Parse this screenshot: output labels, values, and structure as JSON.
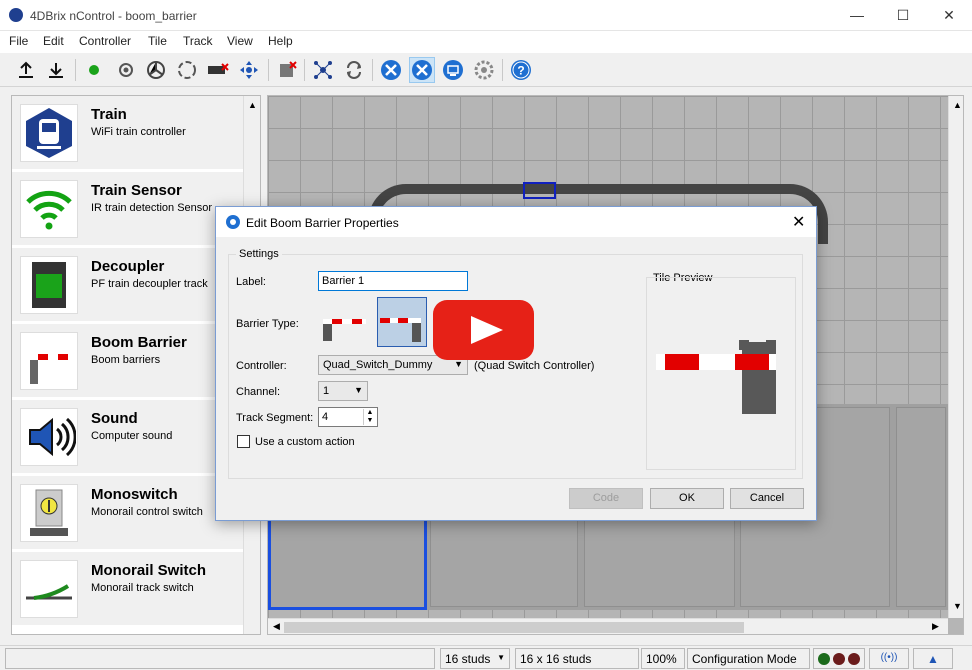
{
  "window": {
    "title": "4DBrix nControl - boom_barrier",
    "minimize": "—",
    "maximize": "☐",
    "close": "✕"
  },
  "menu": [
    "File",
    "Edit",
    "Controller",
    "Tile",
    "Track",
    "View",
    "Help"
  ],
  "toolbar_icons": [
    "upload-icon",
    "download-icon",
    "green-dot-icon",
    "sensor-icon",
    "turntable-icon",
    "circle-icon",
    "decoupler-icon",
    "move-icon",
    "delete-icon",
    "network-icon",
    "loop-icon",
    "tools-icon",
    "tools-active-icon",
    "screen-icon",
    "gear-icon",
    "help-icon"
  ],
  "sidebar": {
    "items": [
      {
        "title": "Train",
        "desc": "WiFi train controller"
      },
      {
        "title": "Train Sensor",
        "desc": "IR train detection Sensor"
      },
      {
        "title": "Decoupler",
        "desc": "PF train decoupler track"
      },
      {
        "title": "Boom Barrier",
        "desc": "Boom barriers"
      },
      {
        "title": "Sound",
        "desc": "Computer sound"
      },
      {
        "title": "Monoswitch",
        "desc": "Monorail control switch"
      },
      {
        "title": "Monorail Switch",
        "desc": "Monorail track switch"
      }
    ]
  },
  "dialog": {
    "title": "Edit Boom Barrier Properties",
    "settings_label": "Settings",
    "label_label": "Label:",
    "label_value": "Barrier 1",
    "barrier_type_label": "Barrier Type:",
    "controller_label": "Controller:",
    "controller_value": "Quad_Switch_Dummy",
    "controller_note": "(Quad Switch Controller)",
    "channel_label": "Channel:",
    "channel_value": "1",
    "track_segment_label": "Track Segment:",
    "track_segment_value": "4",
    "custom_action_label": "Use a custom action",
    "tile_preview_label": "Tile Preview",
    "code_button": "Code",
    "ok_button": "OK",
    "cancel_button": "Cancel"
  },
  "status": {
    "studs": "16 studs",
    "grid": "16 x 16 studs",
    "zoom": "100%",
    "mode": "Configuration Mode"
  },
  "colors": {
    "red": "#e20000",
    "green_signal": "#1c6b1c",
    "blue": "#1f3f8f",
    "accent": "#0063b1"
  }
}
